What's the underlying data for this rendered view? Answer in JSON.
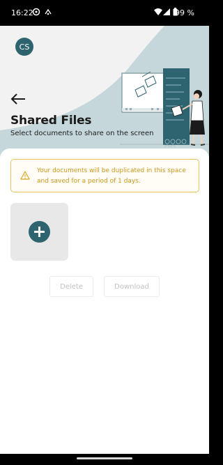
{
  "status_bar": {
    "time": "16:22",
    "battery": "99 %"
  },
  "user": {
    "initials": "CS"
  },
  "header": {
    "title": "Shared Files",
    "subtitle": "Select documents to share on the screen"
  },
  "warning": {
    "text": "Your documents will be duplicated in this space and saved for a period of 1 days."
  },
  "actions": {
    "delete_label": "Delete",
    "download_label": "Download"
  },
  "colors": {
    "accent": "#2e6470",
    "hero": "#c5d7da",
    "warning": "#e7c35a",
    "warning_text": "#c9971a"
  }
}
